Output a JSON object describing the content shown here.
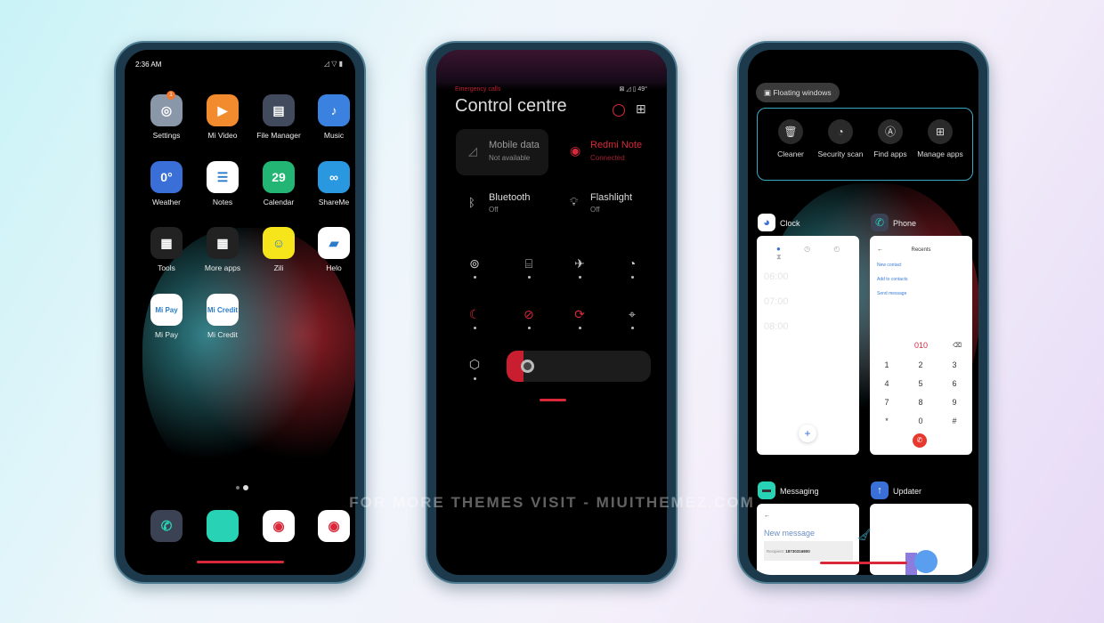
{
  "watermark": "FOR MORE THEMES VISIT - MIUITHEMEZ.COM",
  "home": {
    "time": "2:36 AM",
    "badge": "1",
    "apps": [
      {
        "label": "Settings",
        "icon": "settings-icon",
        "color": "#8a97a8",
        "glyph": "◎"
      },
      {
        "label": "Mi Video",
        "icon": "video-icon",
        "color": "#f18b2e",
        "glyph": "▶"
      },
      {
        "label": "File Manager",
        "icon": "folder-icon",
        "color": "#424a5e",
        "glyph": "▤"
      },
      {
        "label": "Music",
        "icon": "music-icon",
        "color": "#3b82e0",
        "glyph": "♪"
      },
      {
        "label": "Weather",
        "icon": "weather-icon",
        "color": "#3a6fd8",
        "glyph": "0°"
      },
      {
        "label": "Notes",
        "icon": "notes-icon",
        "color": "#ffffff",
        "glyph": "☰"
      },
      {
        "label": "Calendar",
        "icon": "calendar-icon",
        "color": "#22b573",
        "glyph": "29"
      },
      {
        "label": "ShareMe",
        "icon": "shareme-icon",
        "color": "#2a98e0",
        "glyph": "∞"
      },
      {
        "label": "Tools",
        "icon": "folder-icon",
        "color": "#222222",
        "glyph": "▦"
      },
      {
        "label": "More apps",
        "icon": "folder-icon",
        "color": "#222222",
        "glyph": "▦"
      },
      {
        "label": "Zili",
        "icon": "zili-icon",
        "color": "#f7e51c",
        "glyph": "☺"
      },
      {
        "label": "Helo",
        "icon": "helo-icon",
        "color": "#ffffff",
        "glyph": "▰"
      },
      {
        "label": "Mi Pay",
        "icon": "mipay-icon",
        "color": "#ffffff",
        "glyph": "Mi Pay"
      },
      {
        "label": "Mi Credit",
        "icon": "micredit-icon",
        "color": "#ffffff",
        "glyph": "Mi Credit"
      }
    ],
    "dock": [
      {
        "icon": "phone-icon",
        "color": "#3b4254",
        "glyph": "✆"
      },
      {
        "icon": "messaging-icon",
        "color": "#27d3b4",
        "glyph": "▬"
      },
      {
        "icon": "chrome-icon",
        "color": "#ffffff",
        "glyph": "◉"
      },
      {
        "icon": "camera-icon",
        "color": "#ffffff",
        "glyph": "◉"
      }
    ]
  },
  "control": {
    "emergency": "Emergency calls",
    "battery": "49",
    "title": "Control centre",
    "tiles": [
      {
        "title": "Mobile data",
        "status": "Not available"
      },
      {
        "title": "Redmi Note",
        "status": "Connected"
      },
      {
        "title": "Bluetooth",
        "status": "Off"
      },
      {
        "title": "Flashlight",
        "status": "Off"
      }
    ],
    "accent": "#d8283a",
    "brightness": 0.12
  },
  "recents": {
    "floating": "Floating windows",
    "actions": [
      {
        "label": "Cleaner",
        "icon": "trash-icon"
      },
      {
        "label": "Security scan",
        "icon": "security-icon"
      },
      {
        "label": "Find apps",
        "icon": "search-icon"
      },
      {
        "label": "Manage apps",
        "icon": "grid-icon"
      }
    ],
    "clock": {
      "name": "Clock",
      "alarms": [
        "06:00",
        "07:00",
        "08:00"
      ]
    },
    "phone": {
      "name": "Phone",
      "header": "Recents",
      "links": [
        "New contact",
        "Add to contacts",
        "Send message"
      ],
      "number": "010",
      "keys": [
        "1",
        "2",
        "3",
        "4",
        "5",
        "6",
        "7",
        "8",
        "9",
        "*",
        "0",
        "#"
      ]
    },
    "messaging": {
      "name": "Messaging",
      "title": "New message",
      "recipient_label": "Recipient:",
      "recipient": "18730316800"
    },
    "updater": {
      "name": "Updater"
    }
  }
}
